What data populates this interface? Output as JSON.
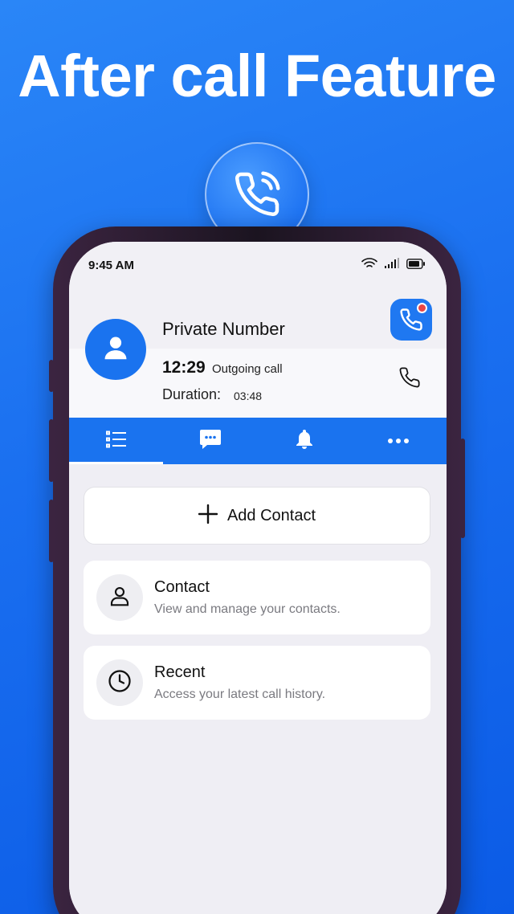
{
  "headline": "After call Feature",
  "status_bar": {
    "time": "9:45 AM"
  },
  "call_info": {
    "caller": "Private Number",
    "time": "12:29",
    "type": "Outgoing call",
    "duration_label": "Duration:",
    "duration_value": "03:48"
  },
  "tabs": [
    {
      "icon": "list-icon",
      "active": true
    },
    {
      "icon": "message-icon",
      "active": false
    },
    {
      "icon": "bell-icon",
      "active": false
    },
    {
      "icon": "more-icon",
      "active": false
    }
  ],
  "actions": {
    "add_contact_label": "Add Contact"
  },
  "items": [
    {
      "title": "Contact",
      "subtitle": "View and manage your contacts.",
      "icon": "person-icon"
    },
    {
      "title": "Recent",
      "subtitle": "Access your latest call history.",
      "icon": "clock-icon"
    }
  ],
  "colors": {
    "brand_blue": "#1a73ef",
    "notification_red": "#e94545"
  }
}
